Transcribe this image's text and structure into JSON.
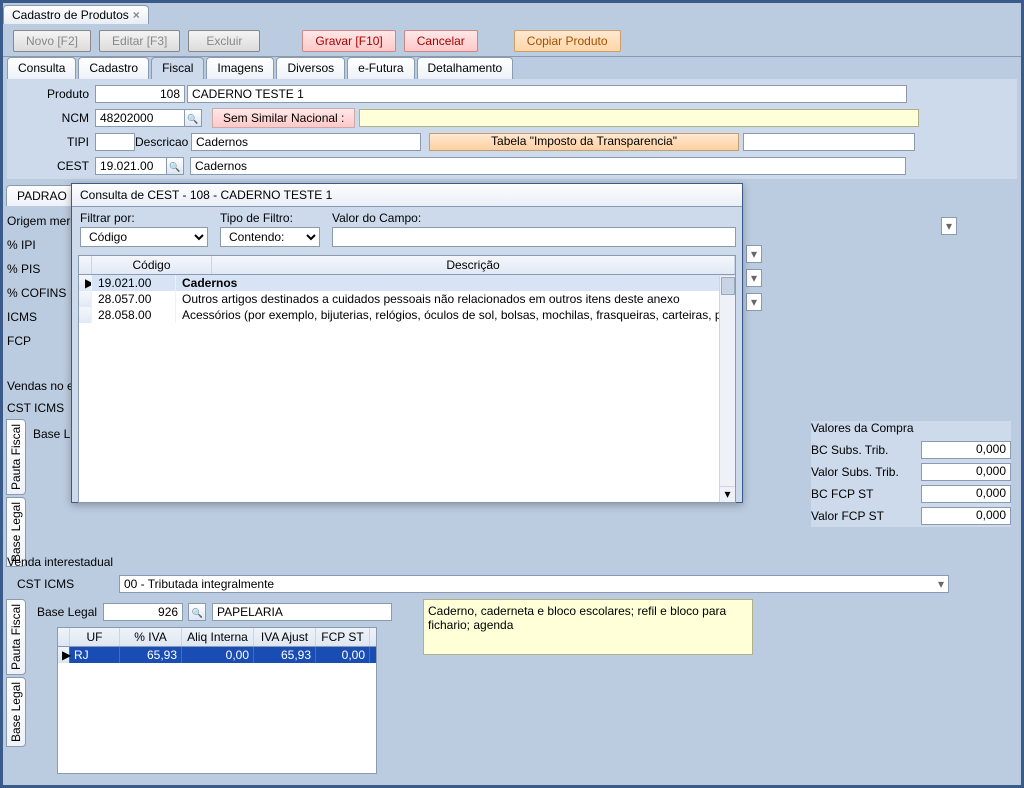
{
  "window_tab": {
    "title": "Cadastro de Produtos"
  },
  "toolbar": {
    "novo": "Novo [F2]",
    "editar": "Editar [F3]",
    "excluir": "Excluir",
    "gravar": "Gravar [F10]",
    "cancelar": "Cancelar",
    "copiar": "Copiar Produto"
  },
  "subtabs": [
    "Consulta",
    "Cadastro",
    "Fiscal",
    "Imagens",
    "Diversos",
    "e-Futura",
    "Detalhamento"
  ],
  "form": {
    "produto_lbl": "Produto",
    "produto_id": "108",
    "produto_desc": "CADERNO TESTE 1",
    "ncm_lbl": "NCM",
    "ncm": "48202000",
    "sem_similar": "Sem Similar Nacional  :",
    "tipi_lbl": "TIPI",
    "descricao_lbl": "Descricao",
    "tipi_desc": "Cadernos",
    "tabela_btn": "Tabela \"Imposto da Transparencia\"",
    "cest_lbl": "CEST",
    "cest": "19.021.00",
    "cest_desc": "Cadernos"
  },
  "padrao_tab": "PADRAO",
  "left_labels": [
    "Origem merc",
    "% IPI",
    "% PIS",
    "% COFINS",
    "ICMS",
    "FCP"
  ],
  "vendas_hdr": "Vendas no es",
  "vendas_lbls": [
    "CST ICMS",
    "Base L"
  ],
  "vtabs_a": [
    "Base Legal",
    "Pauta Fiscal"
  ],
  "valores": {
    "title": "Valores da Compra",
    "rows": [
      {
        "label": "BC Subs. Trib.",
        "value": "0,000"
      },
      {
        "label": "Valor Subs. Trib.",
        "value": "0,000"
      },
      {
        "label": "BC FCP ST",
        "value": "0,000"
      },
      {
        "label": "Valor FCP ST",
        "value": "0,000"
      }
    ]
  },
  "inter": {
    "title": "Venda interestadual",
    "cst_lbl": "CST ICMS",
    "cst_val": "00 - Tributada integralmente",
    "base_lbl": "Base Legal",
    "base_num": "926",
    "base_desc": "PAPELARIA",
    "memo": "Caderno, caderneta e bloco escolares; refil e bloco para fichario; agenda",
    "cols": [
      "UF",
      "% IVA",
      "Aliq Interna",
      "IVA Ajust",
      "FCP ST"
    ],
    "row": [
      "RJ",
      "65,93",
      "0,00",
      "65,93",
      "0,00"
    ]
  },
  "vtabs_b": [
    "Base Legal",
    "Pauta Fiscal"
  ],
  "modal": {
    "title": "Consulta de CEST - 108 - CADERNO TESTE 1",
    "filter_labels": {
      "por": "Filtrar por:",
      "tipo": "Tipo de Filtro:",
      "valor": "Valor do Campo:"
    },
    "filtrar_por": "Código",
    "tipo_filtro": "Contendo:",
    "cols": [
      "Código",
      "Descrição"
    ],
    "rows": [
      {
        "codigo": "19.021.00",
        "desc": "Cadernos"
      },
      {
        "codigo": "28.057.00",
        "desc": "Outros artigos destinados a cuidados pessoais não relacionados em outros itens deste anexo"
      },
      {
        "codigo": "28.058.00",
        "desc": "Acessórios (por exemplo, bijuterias, relógios, óculos de sol, bolsas, mochilas, frasqueiras, carteiras, porta-cartões, po"
      }
    ]
  }
}
